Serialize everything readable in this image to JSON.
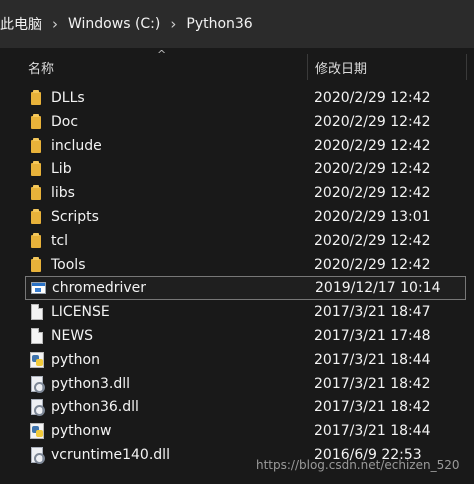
{
  "breadcrumb": {
    "items": [
      "此电脑",
      "Windows (C:)",
      "Python36"
    ],
    "separator": "›"
  },
  "columns": {
    "name": "名称",
    "date": "修改日期",
    "sort_indicator": "^"
  },
  "files": [
    {
      "name": "DLLs",
      "date": "2020/2/29 12:42",
      "icon": "folder-icon"
    },
    {
      "name": "Doc",
      "date": "2020/2/29 12:42",
      "icon": "folder-icon"
    },
    {
      "name": "include",
      "date": "2020/2/29 12:42",
      "icon": "folder-icon"
    },
    {
      "name": "Lib",
      "date": "2020/2/29 12:42",
      "icon": "folder-icon"
    },
    {
      "name": "libs",
      "date": "2020/2/29 12:42",
      "icon": "folder-icon"
    },
    {
      "name": "Scripts",
      "date": "2020/2/29 13:01",
      "icon": "folder-icon"
    },
    {
      "name": "tcl",
      "date": "2020/2/29 12:42",
      "icon": "folder-icon"
    },
    {
      "name": "Tools",
      "date": "2020/2/29 12:42",
      "icon": "folder-icon"
    },
    {
      "name": "chromedriver",
      "date": "2019/12/17 10:14",
      "icon": "executable-icon"
    },
    {
      "name": "LICENSE",
      "date": "2017/3/21 18:47",
      "icon": "file-icon"
    },
    {
      "name": "NEWS",
      "date": "2017/3/21 17:48",
      "icon": "file-icon"
    },
    {
      "name": "python",
      "date": "2017/3/21 18:44",
      "icon": "python-icon"
    },
    {
      "name": "python3.dll",
      "date": "2017/3/21 18:42",
      "icon": "dll-icon"
    },
    {
      "name": "python36.dll",
      "date": "2017/3/21 18:42",
      "icon": "dll-icon"
    },
    {
      "name": "pythonw",
      "date": "2017/3/21 18:44",
      "icon": "python-icon"
    },
    {
      "name": "vcruntime140.dll",
      "date": "2016/6/9 22:53",
      "icon": "dll-icon"
    }
  ],
  "watermark": "https://blog.csdn.net/echizen_520",
  "colors": {
    "background": "#191919",
    "folder": "#e8b23a",
    "selection_border": "#777777"
  }
}
